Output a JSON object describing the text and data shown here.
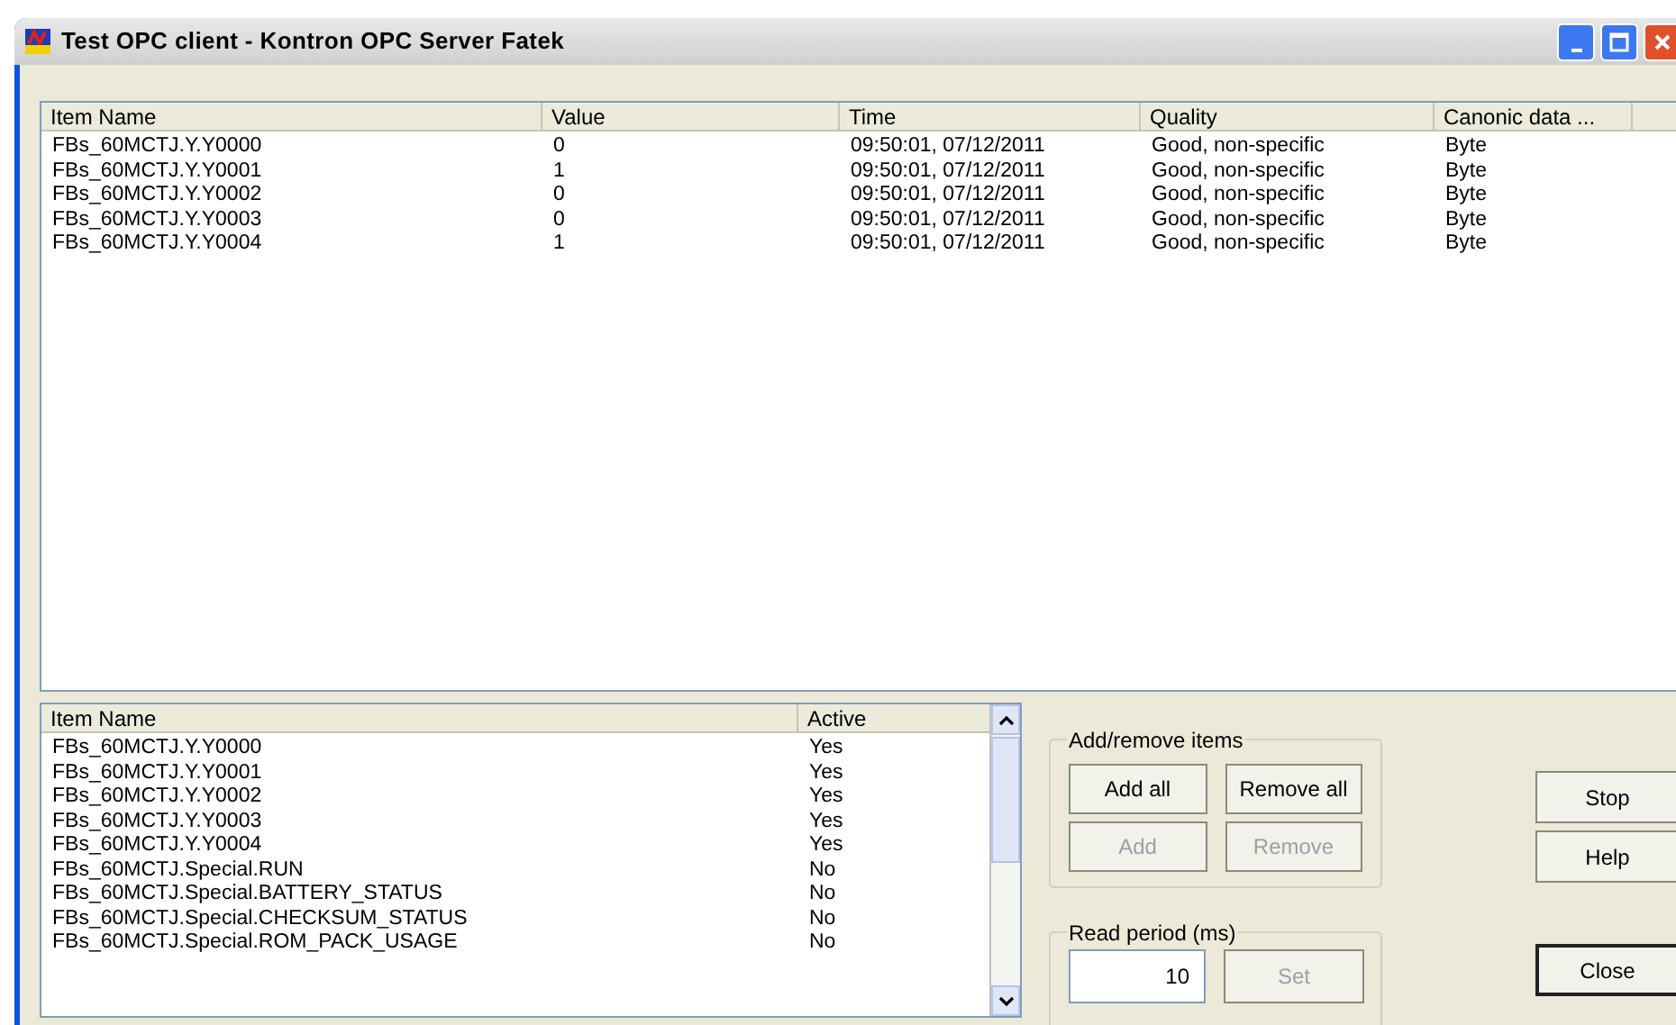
{
  "window": {
    "title": "Test OPC client - Kontron OPC Server Fatek",
    "controls": [
      {
        "kind": "minimize"
      },
      {
        "kind": "maximize"
      },
      {
        "kind": "close"
      }
    ]
  },
  "values_table": {
    "columns": [
      "Item Name",
      "Value",
      "Time",
      "Quality",
      "Canonic data ..."
    ],
    "rows": [
      [
        "FBs_60MCTJ.Y.Y0000",
        "0",
        "09:50:01, 07/12/2011",
        "Good, non-specific",
        "Byte"
      ],
      [
        "FBs_60MCTJ.Y.Y0001",
        "1",
        "09:50:01, 07/12/2011",
        "Good, non-specific",
        "Byte"
      ],
      [
        "FBs_60MCTJ.Y.Y0002",
        "0",
        "09:50:01, 07/12/2011",
        "Good, non-specific",
        "Byte"
      ],
      [
        "FBs_60MCTJ.Y.Y0003",
        "0",
        "09:50:01, 07/12/2011",
        "Good, non-specific",
        "Byte"
      ],
      [
        "FBs_60MCTJ.Y.Y0004",
        "1",
        "09:50:01, 07/12/2011",
        "Good, non-specific",
        "Byte"
      ]
    ]
  },
  "items_table": {
    "columns": [
      "Item Name",
      "Active"
    ],
    "rows": [
      [
        "FBs_60MCTJ.Y.Y0000",
        "Yes"
      ],
      [
        "FBs_60MCTJ.Y.Y0001",
        "Yes"
      ],
      [
        "FBs_60MCTJ.Y.Y0002",
        "Yes"
      ],
      [
        "FBs_60MCTJ.Y.Y0003",
        "Yes"
      ],
      [
        "FBs_60MCTJ.Y.Y0004",
        "Yes"
      ],
      [
        "FBs_60MCTJ.Special.RUN",
        "No"
      ],
      [
        "FBs_60MCTJ.Special.BATTERY_STATUS",
        "No"
      ],
      [
        "FBs_60MCTJ.Special.CHECKSUM_STATUS",
        "No"
      ],
      [
        "FBs_60MCTJ.Special.ROM_PACK_USAGE",
        "No"
      ]
    ]
  },
  "add_remove": {
    "title": "Add/remove items",
    "buttons": [
      {
        "label": "Add all",
        "disabled": false
      },
      {
        "label": "Remove all",
        "disabled": false
      },
      {
        "label": "Add",
        "disabled": true
      },
      {
        "label": "Remove",
        "disabled": true
      }
    ]
  },
  "read_period": {
    "title": "Read period (ms)",
    "value": "10",
    "button": {
      "label": "Set",
      "disabled": true
    }
  },
  "side_buttons": [
    {
      "label": "Stop",
      "default": false
    },
    {
      "label": "Help",
      "default": false
    },
    {
      "label": "Close",
      "default": true
    }
  ]
}
